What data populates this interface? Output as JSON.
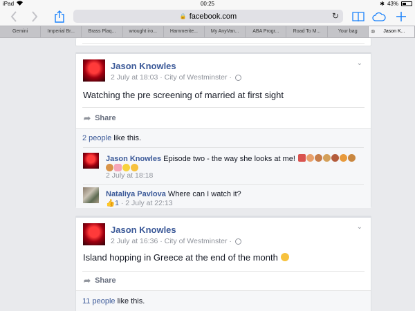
{
  "status_bar": {
    "device": "iPad",
    "wifi": "wifi-icon",
    "time": "00:25",
    "bluetooth": "✱",
    "battery": "43%",
    "battery_level": 0.43
  },
  "toolbar": {
    "url": "facebook.com"
  },
  "tabs": [
    {
      "label": "Gemini"
    },
    {
      "label": "Imperial Br..."
    },
    {
      "label": "Brass Plaq..."
    },
    {
      "label": "wrought iro..."
    },
    {
      "label": "Hammerite..."
    },
    {
      "label": "My AnyVan..."
    },
    {
      "label": "ABA Progr..."
    },
    {
      "label": "Road To M..."
    },
    {
      "label": "Your bag"
    },
    {
      "label": "Jason K...",
      "active": true
    }
  ],
  "posts": [
    {
      "author": "Jason Knowles",
      "meta": "2 July at 18:03 · City of Westminster ·",
      "text": "Watching the pre screening of married at first sight",
      "share_label": "Share",
      "likes_count": "2 people",
      "likes_suffix": " like this.",
      "comments": [
        {
          "author": "Jason Knowles",
          "text": " Episode two - the way she looks at me!",
          "meta": "2 July at 18:18"
        },
        {
          "author": "Nataliya Pavlova",
          "text": " Where can I watch it?",
          "like_count": "1",
          "meta": " · 2 July at 22:13"
        }
      ]
    },
    {
      "author": "Jason Knowles",
      "meta": "2 July at 16:36 · City of Westminster ·",
      "text": "Island hopping in Greece at the end of the month",
      "share_label": "Share",
      "likes_count": "11 people",
      "likes_suffix": " like this."
    }
  ]
}
